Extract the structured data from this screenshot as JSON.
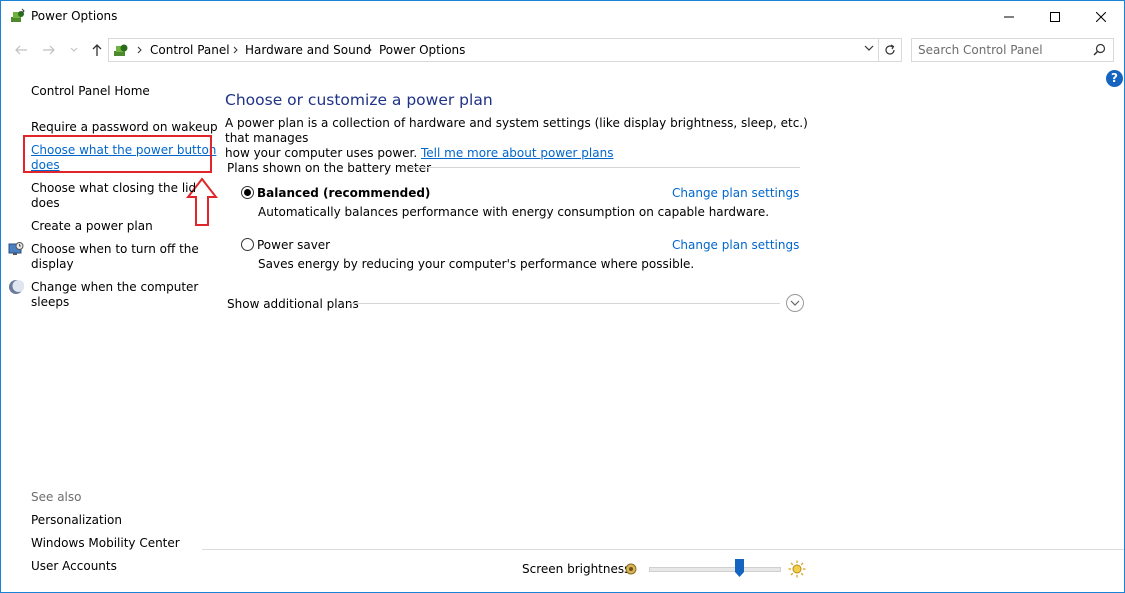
{
  "window": {
    "title": "Power Options",
    "minimize_glyph": "—",
    "maximize_glyph": "☐",
    "close_glyph": "✕"
  },
  "address_bar": {
    "breadcrumbs": [
      "Control Panel",
      "Hardware and Sound",
      "Power Options"
    ],
    "search_placeholder": "Search Control Panel"
  },
  "sidebar": {
    "home": "Control Panel Home",
    "items": [
      {
        "label_line1": "Require a password on wakeup",
        "label_line2": ""
      },
      {
        "label_line1": "Choose what the power button",
        "label_line2": "does",
        "active": true
      },
      {
        "label_line1": "Choose what closing the lid",
        "label_line2": "does"
      },
      {
        "label_line1": "Create a power plan",
        "label_line2": ""
      },
      {
        "label_line1": "Choose when to turn off the",
        "label_line2": "display",
        "icon": "display-clock-icon"
      },
      {
        "label_line1": "Change when the computer",
        "label_line2": "sleeps",
        "icon": "moon-icon"
      }
    ],
    "see_also_title": "See also",
    "see_also": [
      "Personalization",
      "Windows Mobility Center",
      "User Accounts"
    ]
  },
  "main": {
    "heading": "Choose or customize a power plan",
    "description_line1": "A power plan is a collection of hardware and system settings (like display brightness, sleep, etc.) that manages",
    "description_line2": "how your computer uses power.",
    "description_link": "Tell me more about power plans",
    "group_label": "Plans shown on the battery meter",
    "plans": [
      {
        "name": "Balanced (recommended)",
        "description": "Automatically balances performance with energy consumption on capable hardware.",
        "link": "Change plan settings",
        "selected": true
      },
      {
        "name": "Power saver",
        "description": "Saves energy by reducing your computer's performance where possible.",
        "link": "Change plan settings",
        "selected": false
      }
    ],
    "additional_plans": "Show additional plans"
  },
  "footer": {
    "brightness_label": "Screen brightness:",
    "brightness_level": 0.68
  },
  "colors": {
    "link": "#0066cc",
    "heading": "#1e3287",
    "highlight": "#e0262b",
    "slider_thumb": "#1565c0"
  }
}
